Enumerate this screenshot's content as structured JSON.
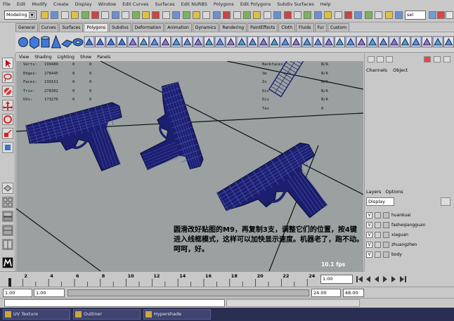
{
  "menubar": [
    "File",
    "Edit",
    "Modify",
    "Create",
    "Display",
    "Window",
    "Edit Curves",
    "Surfaces",
    "Edit NURBS",
    "Polygons",
    "Edit Polygons",
    "Subdiv Surfaces",
    "Help"
  ],
  "status": {
    "mode": "Modeling",
    "sel_label": "sel"
  },
  "shelf_tabs": [
    "General",
    "Curves",
    "Surfaces",
    "Polygons",
    "Subdivs",
    "Deformation",
    "Animation",
    "Dynamics",
    "Rendering",
    "PaintEffects",
    "Cloth",
    "Fluids",
    "Fur",
    "Custom"
  ],
  "active_shelf_tab": "Polygons",
  "viewport": {
    "menu": [
      "View",
      "Shading",
      "Lighting",
      "Show",
      "Panels"
    ],
    "hud_left": [
      {
        "label": "Verts:",
        "v1": "199489",
        "v2": "0",
        "v3": "0"
      },
      {
        "label": "Edges:",
        "v1": "278445",
        "v2": "0",
        "v3": "0"
      },
      {
        "label": "Faces:",
        "v1": "139151",
        "v2": "0",
        "v3": "0"
      },
      {
        "label": "Tris:",
        "v1": "278302",
        "v2": "0",
        "v3": "0"
      },
      {
        "label": "UVs:",
        "v1": "173276",
        "v2": "0",
        "v3": "0"
      }
    ],
    "hud_right": [
      {
        "label": "Backfaces:",
        "value": "N/A"
      },
      {
        "label": "Sm",
        "value": "N/A"
      },
      {
        "label": "In",
        "value": "N/A"
      },
      {
        "label": "Dis",
        "value": "N/A"
      },
      {
        "label": "Dis",
        "value": "N/A"
      },
      {
        "label": "Tex",
        "value": "0"
      }
    ],
    "caption": "圆滑改好贴图的M9，再复制3支，调整它们的位置，按4键进入线框模式，这样可以加快显示速度。机器老了，跑不动。呵呵，好。",
    "fps": "10.1 fps",
    "wire_color": "#1c1f6e"
  },
  "channel_box": {
    "menu": [
      "Channels",
      "Object"
    ]
  },
  "layers": {
    "menu": [
      "Layers",
      "Options"
    ],
    "display_mode": "Display",
    "items": [
      {
        "visible": "V",
        "name": "huankuai"
      },
      {
        "visible": "V",
        "name": "fasheqiangguan"
      },
      {
        "visible": "V",
        "name": "xiaguan"
      },
      {
        "visible": "V",
        "name": "zhuangzhen"
      },
      {
        "visible": "V",
        "name": "body"
      }
    ]
  },
  "time_slider": {
    "ticks": [
      "2",
      "4",
      "6",
      "8",
      "10",
      "12",
      "14",
      "16",
      "18",
      "20",
      "22",
      "24"
    ],
    "current": "1.00"
  },
  "range_slider": {
    "start": "1.00",
    "start_inner": "1.00",
    "end_inner": "24.00",
    "end": "48.00"
  },
  "taskbar": [
    "UV Texture",
    "Outliner",
    "Hypershade"
  ]
}
